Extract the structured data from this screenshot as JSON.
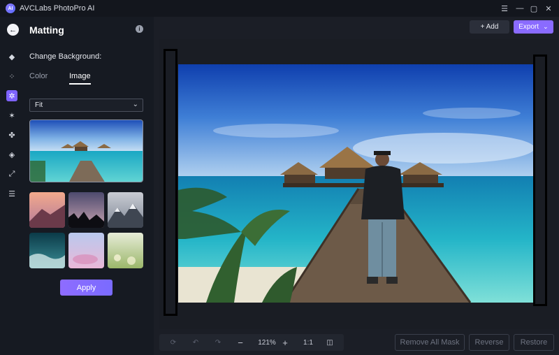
{
  "app": {
    "title": "AVCLabs PhotoPro AI",
    "logo_text": "AI"
  },
  "window_controls": [
    "menu-icon",
    "minimize-icon",
    "maximize-icon",
    "close-icon"
  ],
  "rail": {
    "items": [
      {
        "name": "eraser-icon",
        "glyph": "◆"
      },
      {
        "name": "enhance-icon",
        "glyph": "⁘"
      },
      {
        "name": "matting-icon",
        "glyph": "✲",
        "active": true
      },
      {
        "name": "sparkle-icon",
        "glyph": "✶"
      },
      {
        "name": "fan-icon",
        "glyph": "✤"
      },
      {
        "name": "bucket-icon",
        "glyph": "◈"
      },
      {
        "name": "resize-icon",
        "glyph": "⤢"
      },
      {
        "name": "adjust-icon",
        "glyph": "☰"
      }
    ]
  },
  "panel": {
    "title": "Matting",
    "section_label": "Change Background:",
    "tabs": {
      "color": "Color",
      "image": "Image"
    },
    "fit_select": "Fit",
    "apply_label": "Apply"
  },
  "toolbar": {
    "add_label": "+ Add",
    "export_label": "Export"
  },
  "bottom_bar": {
    "zoom": "121%",
    "ratio": "1:1",
    "zoom_out": "−",
    "zoom_in": "+",
    "remove_all_mask": "Remove All Mask",
    "reverse": "Reverse",
    "restore": "Restore"
  },
  "colors": {
    "accent": "#8a6bff",
    "panel_bg": "#161a22",
    "main_bg": "#1b1e26"
  }
}
